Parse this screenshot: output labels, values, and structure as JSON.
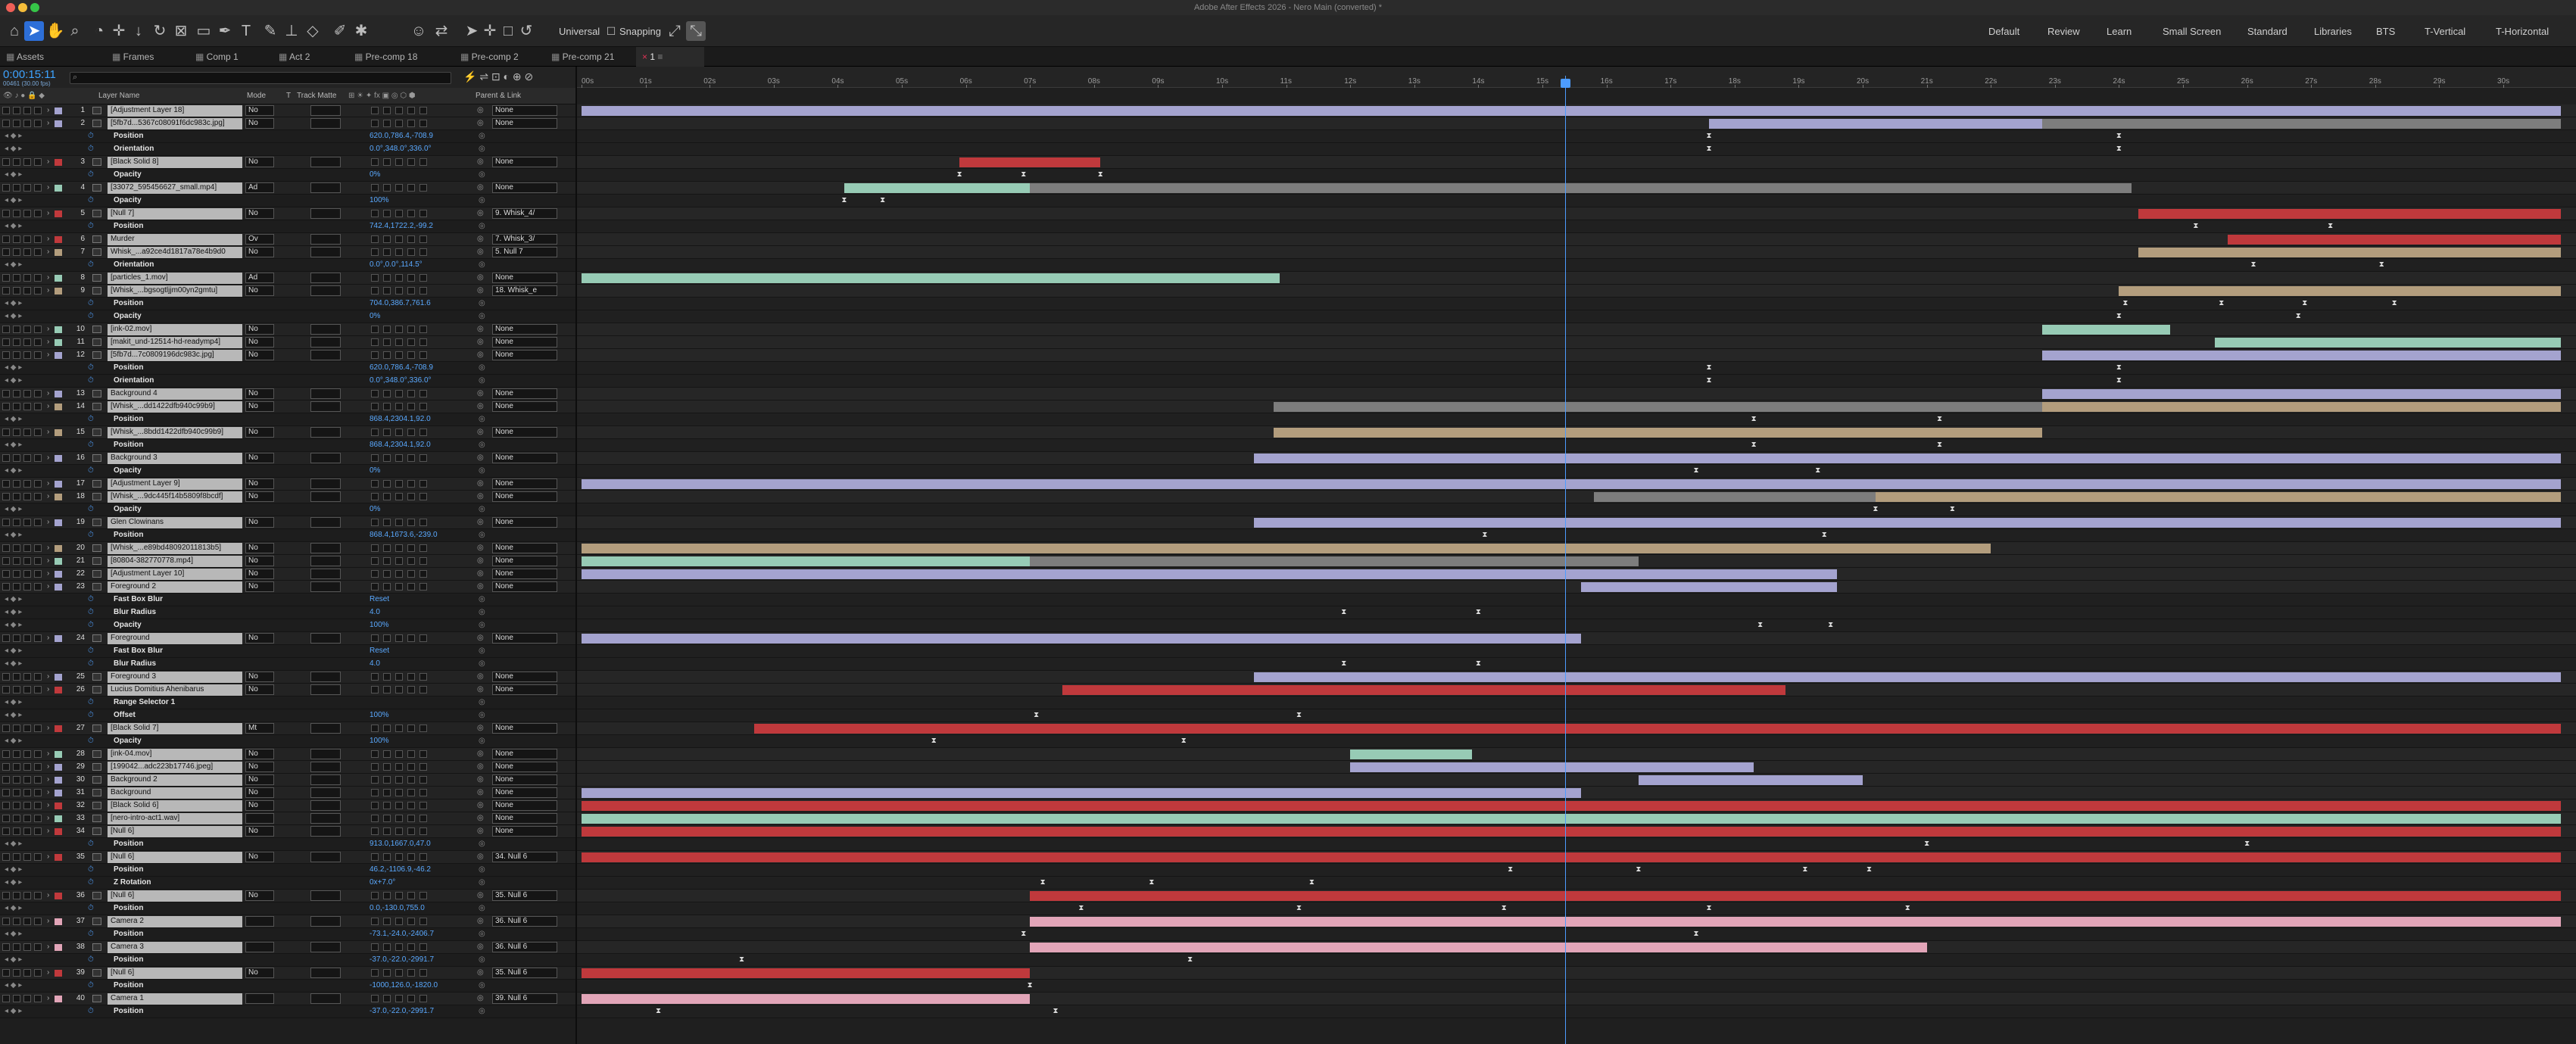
{
  "window": {
    "title": "Adobe After Effects 2026 - Nero Main (converted) *"
  },
  "toolbar": {
    "universal": "Universal",
    "snapping": "Snapping"
  },
  "workspaces": [
    "Default",
    "Review",
    "Learn",
    "Small Screen",
    "Standard",
    "Libraries",
    "BTS",
    "T-Vertical",
    "T-Horizontal"
  ],
  "tabs": [
    "Assets",
    "Frames",
    "Comp 1",
    "Act 2",
    "Pre-comp 18",
    "Pre-comp 2",
    "Pre-comp 21",
    "1"
  ],
  "timecode": "0:00:15:11",
  "fps": "00461 (30.00 fps)",
  "columns": {
    "layer_name": "Layer Name",
    "mode": "Mode",
    "t": "T",
    "track_matte": "Track Matte",
    "parent_link": "Parent & Link"
  },
  "ruler_ticks": [
    "00s",
    "01s",
    "02s",
    "03s",
    "04s",
    "05s",
    "06s",
    "07s",
    "08s",
    "09s",
    "10s",
    "11s",
    "12s",
    "13s",
    "14s",
    "15s",
    "16s",
    "17s",
    "18s",
    "19s",
    "20s",
    "21s",
    "22s",
    "23s",
    "24s",
    "25s",
    "26s",
    "27s",
    "28s",
    "29s",
    "30s"
  ],
  "colors": {
    "lavender": "#a4a3cf",
    "red": "#c0393c",
    "teal": "#97cbb5",
    "tan": "#b39d7d",
    "pink": "#e2a5b8",
    "gray": "#7d7d7d",
    "playhead": "#4d9cff"
  },
  "rows": [
    {
      "t": "L",
      "num": "1",
      "name": "[Adjustment Layer 18]",
      "label": "#a4a3cf",
      "mode": "No",
      "parent": "None",
      "bars": [
        {
          "s": 0,
          "e": 30.9,
          "c": "lavender"
        }
      ]
    },
    {
      "t": "L",
      "num": "2",
      "name": "[5fb7d...5367c08091f6dc983c.jpg]",
      "label": "#a4a3cf",
      "mode": "No",
      "parent": "None",
      "bars": [
        {
          "s": 17.6,
          "e": 22.8,
          "c": "lavender"
        },
        {
          "s": 22.8,
          "e": 30.9,
          "c": "gray"
        }
      ]
    },
    {
      "t": "P",
      "name": "Position",
      "value": "620.0,786.4,-708.9",
      "kf": [
        17.6,
        24.0
      ]
    },
    {
      "t": "P",
      "name": "Orientation",
      "value": "0.0°,348.0°,336.0°",
      "kf": [
        17.6,
        24.0
      ]
    },
    {
      "t": "L",
      "num": "3",
      "name": "[Black Solid 8]",
      "label": "#c0393c",
      "mode": "No",
      "parent": "None",
      "bars": [
        {
          "s": 5.9,
          "e": 8.1,
          "c": "red"
        }
      ]
    },
    {
      "t": "P",
      "name": "Opacity",
      "value": "0%",
      "kf": [
        5.9,
        6.9,
        8.1
      ]
    },
    {
      "t": "L",
      "num": "4",
      "name": "[33072_595456627_small.mp4]",
      "label": "#97cbb5",
      "mode": "Ad",
      "parent": "None",
      "bars": [
        {
          "s": 4.1,
          "e": 7.0,
          "c": "teal"
        },
        {
          "s": 7.0,
          "e": 24.2,
          "c": "gray"
        }
      ]
    },
    {
      "t": "P",
      "name": "Opacity",
      "value": "100%",
      "kf": [
        4.1,
        4.7
      ]
    },
    {
      "t": "L",
      "num": "5",
      "name": "[Null 7]",
      "label": "#c0393c",
      "mode": "No",
      "parent": "9. Whisk_4/",
      "bars": [
        {
          "s": 24.3,
          "e": 30.9,
          "c": "red"
        }
      ]
    },
    {
      "t": "P",
      "name": "Position",
      "value": "742.4,1722.2,-99.2",
      "kf": [
        25.2,
        27.3
      ]
    },
    {
      "t": "L",
      "num": "6",
      "name": "Murder",
      "label": "#c0393c",
      "mode": "Ov",
      "parent": "7. Whisk_3/",
      "bars": [
        {
          "s": 25.7,
          "e": 30.9,
          "c": "red"
        }
      ]
    },
    {
      "t": "L",
      "num": "7",
      "name": "Whisk_...a92ce4d1817a78e4b9d0",
      "label": "#b39d7d",
      "mode": "No",
      "parent": "5. Null 7",
      "bars": [
        {
          "s": 24.3,
          "e": 30.9,
          "c": "tan"
        }
      ]
    },
    {
      "t": "P",
      "name": "Orientation",
      "value": "0.0°,0.0°,114.5°",
      "kf": [
        26.1,
        28.1
      ]
    },
    {
      "t": "L",
      "num": "8",
      "name": "[particles_1.mov]",
      "label": "#97cbb5",
      "mode": "Ad",
      "parent": "None",
      "bars": [
        {
          "s": 0,
          "e": 10.9,
          "c": "teal"
        }
      ]
    },
    {
      "t": "L",
      "num": "9",
      "name": "[Whisk_...bgsogtljjm00yn2gmtu]",
      "label": "#b39d7d",
      "mode": "No",
      "parent": "18. Whisk_e",
      "bars": [
        {
          "s": 24.0,
          "e": 30.9,
          "c": "tan"
        }
      ]
    },
    {
      "t": "P",
      "name": "Position",
      "value": "704.0,386.7,761.6",
      "kf": [
        24.1,
        25.6,
        26.9,
        28.3
      ]
    },
    {
      "t": "P",
      "name": "Opacity",
      "value": "0%",
      "kf": [
        24.0,
        26.8
      ]
    },
    {
      "t": "L",
      "num": "10",
      "name": "[ink-02.mov]",
      "label": "#97cbb5",
      "mode": "No",
      "parent": "None",
      "bars": [
        {
          "s": 22.8,
          "e": 24.8,
          "c": "teal"
        }
      ]
    },
    {
      "t": "L",
      "num": "11",
      "name": "[makit_und-12514-hd-readymp4]",
      "label": "#97cbb5",
      "mode": "No",
      "parent": "None",
      "bars": [
        {
          "s": 25.5,
          "e": 30.9,
          "c": "teal"
        }
      ]
    },
    {
      "t": "L",
      "num": "12",
      "name": "[5fb7d...7c0809196dc983c.jpg]",
      "label": "#a4a3cf",
      "mode": "No",
      "parent": "None",
      "bars": [
        {
          "s": 22.8,
          "e": 30.9,
          "c": "lavender"
        }
      ]
    },
    {
      "t": "P",
      "name": "Position",
      "value": "620.0,786.4,-708.9",
      "kf": [
        17.6,
        24.0
      ]
    },
    {
      "t": "P",
      "name": "Orientation",
      "value": "0.0°,348.0°,336.0°",
      "kf": [
        17.6,
        24.0
      ]
    },
    {
      "t": "L",
      "num": "13",
      "name": "Background 4",
      "label": "#a4a3cf",
      "mode": "No",
      "parent": "None",
      "bars": [
        {
          "s": 22.8,
          "e": 30.9,
          "c": "lavender"
        }
      ]
    },
    {
      "t": "L",
      "num": "14",
      "name": "[Whisk_...dd1422dfb940c99b9]",
      "label": "#b39d7d",
      "mode": "No",
      "parent": "None",
      "bars": [
        {
          "s": 10.8,
          "e": 22.8,
          "c": "gray"
        },
        {
          "s": 22.8,
          "e": 30.9,
          "c": "tan"
        }
      ]
    },
    {
      "t": "P",
      "name": "Position",
      "value": "868.4,2304.1,92.0",
      "kf": [
        18.3,
        21.2
      ]
    },
    {
      "t": "L",
      "num": "15",
      "name": "[Whisk_...8bdd1422dfb940c99b9]",
      "label": "#b39d7d",
      "mode": "No",
      "parent": "None",
      "bars": [
        {
          "s": 10.8,
          "e": 22.8,
          "c": "tan"
        }
      ]
    },
    {
      "t": "P",
      "name": "Position",
      "value": "868.4,2304.1,92.0",
      "kf": [
        18.3,
        21.2
      ]
    },
    {
      "t": "L",
      "num": "16",
      "name": "Background 3",
      "label": "#a4a3cf",
      "mode": "No",
      "parent": "None",
      "bars": [
        {
          "s": 10.5,
          "e": 30.9,
          "c": "lavender"
        }
      ]
    },
    {
      "t": "P",
      "name": "Opacity",
      "value": "0%",
      "kf": [
        17.4,
        19.3
      ]
    },
    {
      "t": "L",
      "num": "17",
      "name": "[Adjustment Layer 9]",
      "label": "#a4a3cf",
      "mode": "No",
      "parent": "None",
      "bars": [
        {
          "s": 0,
          "e": 30.9,
          "c": "lavender"
        }
      ]
    },
    {
      "t": "L",
      "num": "18",
      "name": "[Whisk_...9dc445f14b5809f8bcdf]",
      "label": "#b39d7d",
      "mode": "No",
      "parent": "None",
      "bars": [
        {
          "s": 15.8,
          "e": 20.2,
          "c": "gray"
        },
        {
          "s": 20.2,
          "e": 30.9,
          "c": "tan"
        }
      ]
    },
    {
      "t": "P",
      "name": "Opacity",
      "value": "0%",
      "kf": [
        20.2,
        21.4
      ]
    },
    {
      "t": "L",
      "num": "19",
      "name": "Glen Clowinans",
      "label": "#a4a3cf",
      "mode": "No",
      "parent": "None",
      "bars": [
        {
          "s": 10.5,
          "e": 30.9,
          "c": "lavender"
        }
      ]
    },
    {
      "t": "P",
      "name": "Position",
      "value": "868.4,1673.6,-239.0",
      "kf": [
        14.1,
        19.4
      ]
    },
    {
      "t": "L",
      "num": "20",
      "name": "[Whisk_...e89bd48092011813b5]",
      "label": "#b39d7d",
      "mode": "No",
      "parent": "None",
      "bars": [
        {
          "s": 0,
          "e": 22.0,
          "c": "tan"
        }
      ]
    },
    {
      "t": "L",
      "num": "21",
      "name": "[80804-382770778.mp4]",
      "label": "#97cbb5",
      "mode": "No",
      "parent": "None",
      "bars": [
        {
          "s": 0,
          "e": 7.0,
          "c": "teal"
        },
        {
          "s": 7.0,
          "e": 16.5,
          "c": "gray"
        }
      ]
    },
    {
      "t": "L",
      "num": "22",
      "name": "[Adjustment Layer 10]",
      "label": "#a4a3cf",
      "mode": "No",
      "parent": "None",
      "bars": [
        {
          "s": 0,
          "e": 19.6,
          "c": "lavender"
        }
      ]
    },
    {
      "t": "L",
      "num": "23",
      "name": "Foreground 2",
      "label": "#a4a3cf",
      "mode": "No",
      "parent": "None",
      "bars": [
        {
          "s": 15.6,
          "e": 19.6,
          "c": "lavender"
        }
      ]
    },
    {
      "t": "P",
      "name": "Fast Box Blur",
      "value": "Reset",
      "kf": []
    },
    {
      "t": "P",
      "name": "Blur Radius",
      "value": "4.0",
      "kf": [
        11.9,
        14.0
      ]
    },
    {
      "t": "P",
      "name": "Opacity",
      "value": "100%",
      "kf": [
        18.4,
        19.5
      ]
    },
    {
      "t": "L",
      "num": "24",
      "name": "Foreground",
      "label": "#a4a3cf",
      "mode": "No",
      "parent": "None",
      "bars": [
        {
          "s": 0,
          "e": 15.6,
          "c": "lavender"
        }
      ]
    },
    {
      "t": "P",
      "name": "Fast Box Blur",
      "value": "Reset",
      "kf": []
    },
    {
      "t": "P",
      "name": "Blur Radius",
      "value": "4.0",
      "kf": [
        11.9,
        14.0
      ]
    },
    {
      "t": "L",
      "num": "25",
      "name": "Foreground 3",
      "label": "#a4a3cf",
      "mode": "No",
      "parent": "None",
      "bars": [
        {
          "s": 10.5,
          "e": 30.9,
          "c": "lavender"
        }
      ]
    },
    {
      "t": "L",
      "num": "26",
      "name": "Lucius Domitius Ahenibarus",
      "label": "#c0393c",
      "mode": "No",
      "parent": "None",
      "bars": [
        {
          "s": 7.5,
          "e": 18.8,
          "c": "red"
        }
      ]
    },
    {
      "t": "P",
      "name": "Range Selector 1",
      "value": "",
      "kf": []
    },
    {
      "t": "P",
      "name": "Offset",
      "value": "100%",
      "kf": [
        7.1,
        11.2
      ]
    },
    {
      "t": "L",
      "num": "27",
      "name": "[Black Solid 7]",
      "label": "#c0393c",
      "mode": "Mt",
      "parent": "None",
      "bars": [
        {
          "s": 2.7,
          "e": 30.9,
          "c": "red"
        }
      ]
    },
    {
      "t": "P",
      "name": "Opacity",
      "value": "100%",
      "kf": [
        5.5,
        9.4
      ]
    },
    {
      "t": "L",
      "num": "28",
      "name": "[ink-04.mov]",
      "label": "#97cbb5",
      "mode": "No",
      "parent": "None",
      "bars": [
        {
          "s": 12.0,
          "e": 13.9,
          "c": "teal"
        }
      ]
    },
    {
      "t": "L",
      "num": "29",
      "name": "[199042...adc223b17746.jpeg]",
      "label": "#a4a3cf",
      "mode": "No",
      "parent": "None",
      "bars": [
        {
          "s": 12.0,
          "e": 18.3,
          "c": "lavender"
        }
      ]
    },
    {
      "t": "L",
      "num": "30",
      "name": "Background 2",
      "label": "#a4a3cf",
      "mode": "No",
      "parent": "None",
      "bars": [
        {
          "s": 16.5,
          "e": 20.0,
          "c": "lavender"
        }
      ]
    },
    {
      "t": "L",
      "num": "31",
      "name": "Background",
      "label": "#a4a3cf",
      "mode": "No",
      "parent": "None",
      "bars": [
        {
          "s": 0,
          "e": 15.6,
          "c": "lavender"
        }
      ]
    },
    {
      "t": "L",
      "num": "32",
      "name": "[Black Solid 6]",
      "label": "#c0393c",
      "mode": "No",
      "parent": "None",
      "bars": [
        {
          "s": 0,
          "e": 30.9,
          "c": "red"
        }
      ]
    },
    {
      "t": "L",
      "num": "33",
      "name": "[nero-intro-act1.wav]",
      "label": "#97cbb5",
      "mode": "",
      "parent": "None",
      "bars": [
        {
          "s": 0,
          "e": 30.9,
          "c": "teal"
        }
      ]
    },
    {
      "t": "L",
      "num": "34",
      "name": "[Null 6]",
      "label": "#c0393c",
      "mode": "No",
      "parent": "None",
      "bars": [
        {
          "s": 0,
          "e": 30.9,
          "c": "red"
        }
      ]
    },
    {
      "t": "P",
      "name": "Position",
      "value": "913.0,1667.0,47.0",
      "kf": [
        21.0,
        26.0
      ]
    },
    {
      "t": "L",
      "num": "35",
      "name": "[Null 6]",
      "label": "#c0393c",
      "mode": "No",
      "parent": "34. Null 6",
      "bars": [
        {
          "s": 0,
          "e": 30.9,
          "c": "red"
        }
      ]
    },
    {
      "t": "P",
      "name": "Position",
      "value": "46.2,-1106.9,-46.2",
      "kf": [
        14.5,
        16.5,
        19.1,
        20.1
      ]
    },
    {
      "t": "P",
      "name": "Z Rotation",
      "value": "0x+7.0°",
      "kf": [
        7.2,
        8.9,
        11.4
      ]
    },
    {
      "t": "L",
      "num": "36",
      "name": "[Null 6]",
      "label": "#c0393c",
      "mode": "No",
      "parent": "35. Null 6",
      "bars": [
        {
          "s": 7.0,
          "e": 30.9,
          "c": "red"
        }
      ]
    },
    {
      "t": "P",
      "name": "Position",
      "value": "0.0,-130.0,755.0",
      "kf": [
        7.8,
        11.2,
        14.4,
        17.6,
        20.7
      ]
    },
    {
      "t": "L",
      "num": "37",
      "name": "Camera 2",
      "label": "#e2a5b8",
      "mode": "",
      "parent": "36. Null 6",
      "bars": [
        {
          "s": 7.0,
          "e": 30.9,
          "c": "pink"
        }
      ]
    },
    {
      "t": "P",
      "name": "Position",
      "value": "-73.1,-24.0,-2406.7",
      "kf": [
        6.9,
        17.4
      ]
    },
    {
      "t": "L",
      "num": "38",
      "name": "Camera 3",
      "label": "#e2a5b8",
      "mode": "",
      "parent": "36. Null 6",
      "bars": [
        {
          "s": 7.0,
          "e": 21.0,
          "c": "pink"
        }
      ]
    },
    {
      "t": "P",
      "name": "Position",
      "value": "-37.0,-22.0,-2991.7",
      "kf": [
        2.5,
        9.5
      ]
    },
    {
      "t": "L",
      "num": "39",
      "name": "[Null 6]",
      "label": "#c0393c",
      "mode": "No",
      "parent": "35. Null 6",
      "bars": [
        {
          "s": 0,
          "e": 7.0,
          "c": "red"
        }
      ]
    },
    {
      "t": "P",
      "name": "Position",
      "value": "-1000,126.0,-1820.0",
      "kf": [
        7.0
      ]
    },
    {
      "t": "L",
      "num": "40",
      "name": "Camera 1",
      "label": "#e2a5b8",
      "mode": "",
      "parent": "39. Null 6",
      "bars": [
        {
          "s": 0,
          "e": 7.0,
          "c": "pink"
        }
      ]
    },
    {
      "t": "P",
      "name": "Position",
      "value": "-37.0,-22.0,-2991.7",
      "kf": [
        1.2,
        7.4
      ]
    }
  ]
}
